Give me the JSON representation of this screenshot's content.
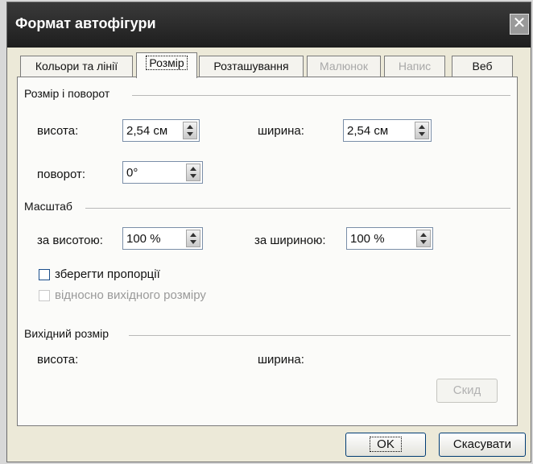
{
  "window": {
    "title": "Формат автофігури"
  },
  "tabs": [
    {
      "label": "Кольори та лінії",
      "state": "normal"
    },
    {
      "label": "Розмір",
      "state": "active"
    },
    {
      "label": "Розташування",
      "state": "normal"
    },
    {
      "label": "Малюнок",
      "state": "disabled"
    },
    {
      "label": "Напис",
      "state": "disabled"
    },
    {
      "label": "Веб",
      "state": "normal"
    }
  ],
  "size_rotate": {
    "title": "Розмір і поворот",
    "height_label": "висота:",
    "height_value": "2,54 см",
    "width_label": "ширина:",
    "width_value": "2,54 см",
    "rotation_label": "поворот:",
    "rotation_value": "0°"
  },
  "scale": {
    "title": "Масштаб",
    "height_label": "за висотою:",
    "height_value": "100 %",
    "width_label": "за шириною:",
    "width_value": "100 %",
    "lock_aspect_label": "зберегти пропорції",
    "relative_label": "відносно вихідного розміру"
  },
  "original_size": {
    "title": "Вихідний розмір",
    "height_label": "висота:",
    "width_label": "ширина:",
    "reset_label": "Скид"
  },
  "buttons": {
    "ok": "OK",
    "cancel": "Скасувати"
  },
  "close_glyph": "✕"
}
